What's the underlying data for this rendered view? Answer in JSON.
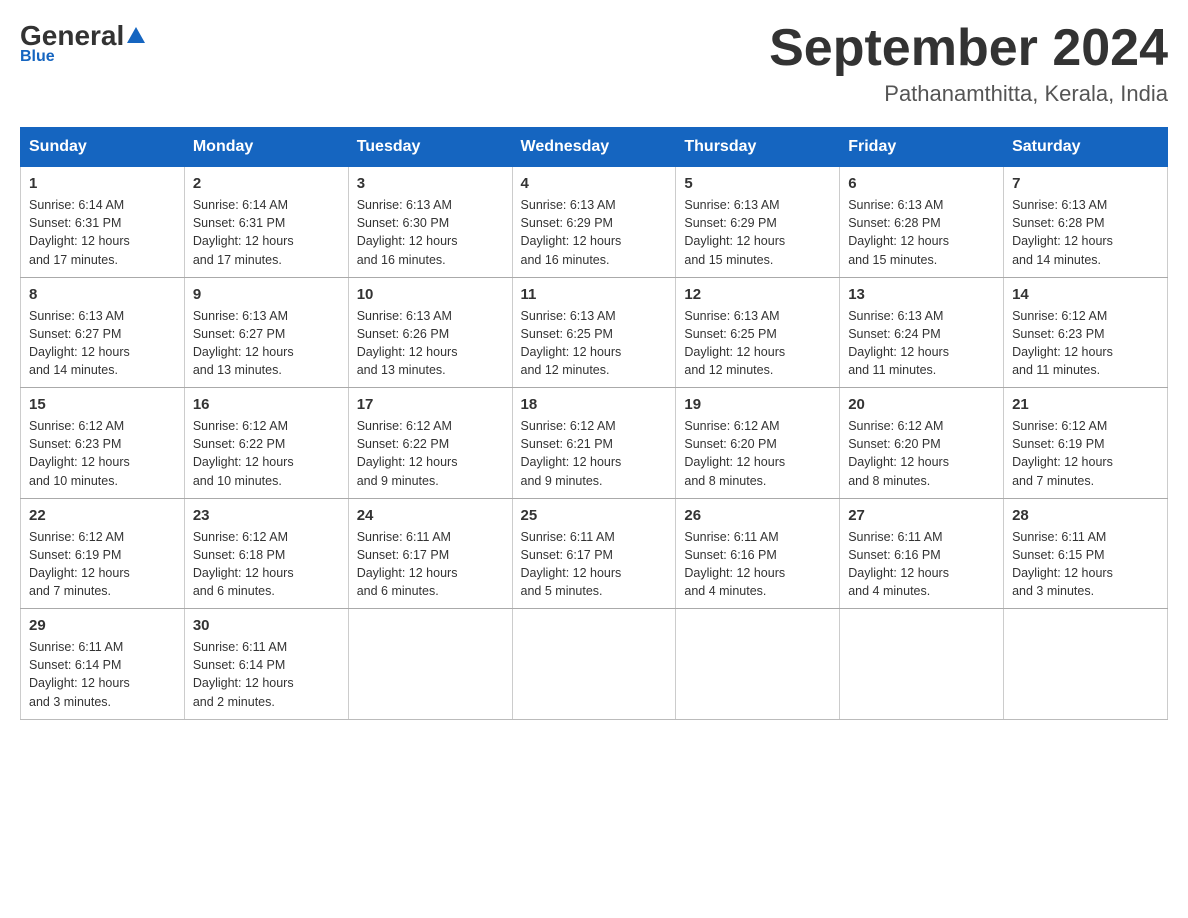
{
  "header": {
    "logo_general": "General",
    "logo_blue": "Blue",
    "month_title": "September 2024",
    "location": "Pathanamthitta, Kerala, India"
  },
  "weekdays": [
    "Sunday",
    "Monday",
    "Tuesday",
    "Wednesday",
    "Thursday",
    "Friday",
    "Saturday"
  ],
  "weeks": [
    [
      {
        "day": "1",
        "sunrise": "6:14 AM",
        "sunset": "6:31 PM",
        "daylight": "12 hours and 17 minutes."
      },
      {
        "day": "2",
        "sunrise": "6:14 AM",
        "sunset": "6:31 PM",
        "daylight": "12 hours and 17 minutes."
      },
      {
        "day": "3",
        "sunrise": "6:13 AM",
        "sunset": "6:30 PM",
        "daylight": "12 hours and 16 minutes."
      },
      {
        "day": "4",
        "sunrise": "6:13 AM",
        "sunset": "6:29 PM",
        "daylight": "12 hours and 16 minutes."
      },
      {
        "day": "5",
        "sunrise": "6:13 AM",
        "sunset": "6:29 PM",
        "daylight": "12 hours and 15 minutes."
      },
      {
        "day": "6",
        "sunrise": "6:13 AM",
        "sunset": "6:28 PM",
        "daylight": "12 hours and 15 minutes."
      },
      {
        "day": "7",
        "sunrise": "6:13 AM",
        "sunset": "6:28 PM",
        "daylight": "12 hours and 14 minutes."
      }
    ],
    [
      {
        "day": "8",
        "sunrise": "6:13 AM",
        "sunset": "6:27 PM",
        "daylight": "12 hours and 14 minutes."
      },
      {
        "day": "9",
        "sunrise": "6:13 AM",
        "sunset": "6:27 PM",
        "daylight": "12 hours and 13 minutes."
      },
      {
        "day": "10",
        "sunrise": "6:13 AM",
        "sunset": "6:26 PM",
        "daylight": "12 hours and 13 minutes."
      },
      {
        "day": "11",
        "sunrise": "6:13 AM",
        "sunset": "6:25 PM",
        "daylight": "12 hours and 12 minutes."
      },
      {
        "day": "12",
        "sunrise": "6:13 AM",
        "sunset": "6:25 PM",
        "daylight": "12 hours and 12 minutes."
      },
      {
        "day": "13",
        "sunrise": "6:13 AM",
        "sunset": "6:24 PM",
        "daylight": "12 hours and 11 minutes."
      },
      {
        "day": "14",
        "sunrise": "6:12 AM",
        "sunset": "6:23 PM",
        "daylight": "12 hours and 11 minutes."
      }
    ],
    [
      {
        "day": "15",
        "sunrise": "6:12 AM",
        "sunset": "6:23 PM",
        "daylight": "12 hours and 10 minutes."
      },
      {
        "day": "16",
        "sunrise": "6:12 AM",
        "sunset": "6:22 PM",
        "daylight": "12 hours and 10 minutes."
      },
      {
        "day": "17",
        "sunrise": "6:12 AM",
        "sunset": "6:22 PM",
        "daylight": "12 hours and 9 minutes."
      },
      {
        "day": "18",
        "sunrise": "6:12 AM",
        "sunset": "6:21 PM",
        "daylight": "12 hours and 9 minutes."
      },
      {
        "day": "19",
        "sunrise": "6:12 AM",
        "sunset": "6:20 PM",
        "daylight": "12 hours and 8 minutes."
      },
      {
        "day": "20",
        "sunrise": "6:12 AM",
        "sunset": "6:20 PM",
        "daylight": "12 hours and 8 minutes."
      },
      {
        "day": "21",
        "sunrise": "6:12 AM",
        "sunset": "6:19 PM",
        "daylight": "12 hours and 7 minutes."
      }
    ],
    [
      {
        "day": "22",
        "sunrise": "6:12 AM",
        "sunset": "6:19 PM",
        "daylight": "12 hours and 7 minutes."
      },
      {
        "day": "23",
        "sunrise": "6:12 AM",
        "sunset": "6:18 PM",
        "daylight": "12 hours and 6 minutes."
      },
      {
        "day": "24",
        "sunrise": "6:11 AM",
        "sunset": "6:17 PM",
        "daylight": "12 hours and 6 minutes."
      },
      {
        "day": "25",
        "sunrise": "6:11 AM",
        "sunset": "6:17 PM",
        "daylight": "12 hours and 5 minutes."
      },
      {
        "day": "26",
        "sunrise": "6:11 AM",
        "sunset": "6:16 PM",
        "daylight": "12 hours and 4 minutes."
      },
      {
        "day": "27",
        "sunrise": "6:11 AM",
        "sunset": "6:16 PM",
        "daylight": "12 hours and 4 minutes."
      },
      {
        "day": "28",
        "sunrise": "6:11 AM",
        "sunset": "6:15 PM",
        "daylight": "12 hours and 3 minutes."
      }
    ],
    [
      {
        "day": "29",
        "sunrise": "6:11 AM",
        "sunset": "6:14 PM",
        "daylight": "12 hours and 3 minutes."
      },
      {
        "day": "30",
        "sunrise": "6:11 AM",
        "sunset": "6:14 PM",
        "daylight": "12 hours and 2 minutes."
      },
      null,
      null,
      null,
      null,
      null
    ]
  ],
  "labels": {
    "sunrise": "Sunrise:",
    "sunset": "Sunset:",
    "daylight": "Daylight:"
  }
}
